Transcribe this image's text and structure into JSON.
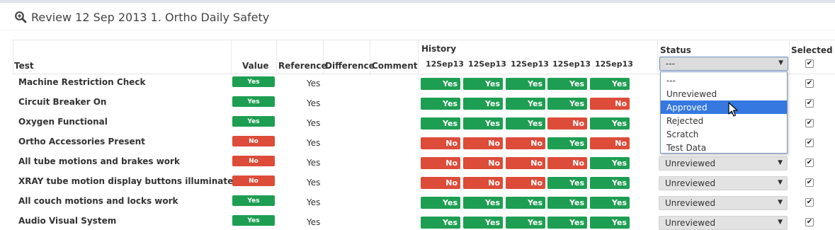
{
  "page": {
    "title": "Review 12 Sep 2013 1. Ortho Daily Safety",
    "title_icon": "zoom-in-icon"
  },
  "colors": {
    "yes": "#1e9e52",
    "no": "#dd4b39",
    "select_highlight": "#3478e0"
  },
  "table": {
    "headers": {
      "test": "Test",
      "value": "Value",
      "reference": "Reference",
      "difference": "Difference",
      "comment": "Comment",
      "history": "History",
      "status": "Status",
      "selected": "Selected"
    },
    "history_dates": [
      "12Sep13",
      "12Sep13",
      "12Sep13",
      "12Sep13",
      "12Sep13"
    ],
    "rows": [
      {
        "test": "Machine Restriction Check",
        "value": "Yes",
        "reference": "Yes",
        "history": [
          "Yes",
          "Yes",
          "Yes",
          "Yes",
          "Yes"
        ],
        "status": "---",
        "selected": true
      },
      {
        "test": "Circuit Breaker On",
        "value": "Yes",
        "reference": "Yes",
        "history": [
          "Yes",
          "Yes",
          "Yes",
          "Yes",
          "No"
        ],
        "status": "",
        "selected": true
      },
      {
        "test": "Oxygen Functional",
        "value": "Yes",
        "reference": "Yes",
        "history": [
          "Yes",
          "Yes",
          "Yes",
          "No",
          "Yes"
        ],
        "status": "",
        "selected": true
      },
      {
        "test": "Ortho Accessories Present",
        "value": "No",
        "reference": "Yes",
        "history": [
          "No",
          "No",
          "No",
          "Yes",
          "No"
        ],
        "status": "",
        "selected": true
      },
      {
        "test": "All tube motions and brakes work",
        "value": "No",
        "reference": "Yes",
        "history": [
          "No",
          "No",
          "No",
          "No",
          "Yes"
        ],
        "status": "Unreviewed",
        "selected": true
      },
      {
        "test": "XRAY tube motion display buttons illuminated",
        "value": "No",
        "reference": "Yes",
        "history": [
          "No",
          "No",
          "No",
          "Yes",
          "Yes"
        ],
        "status": "Unreviewed",
        "selected": true
      },
      {
        "test": "All couch motions and locks work",
        "value": "Yes",
        "reference": "Yes",
        "history": [
          "Yes",
          "Yes",
          "Yes",
          "Yes",
          "Yes"
        ],
        "status": "Unreviewed",
        "selected": true
      },
      {
        "test": "Audio Visual System",
        "value": "Yes",
        "reference": "Yes",
        "history": [
          "Yes",
          "Yes",
          "Yes",
          "Yes",
          "Yes"
        ],
        "status": "Unreviewed",
        "selected": true
      }
    ]
  },
  "status_dropdown": {
    "current": "---",
    "options": [
      "---",
      "Unreviewed",
      "Approved",
      "Rejected",
      "Scratch",
      "Test Data"
    ],
    "highlighted": "Approved"
  },
  "icons": {
    "checkbox_mark": "✔",
    "select_arrow": "▼"
  }
}
